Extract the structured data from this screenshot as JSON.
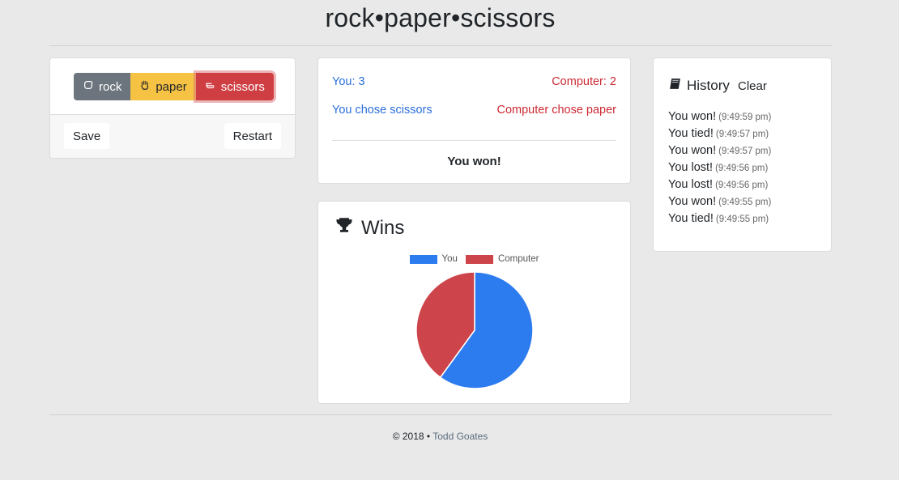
{
  "header": {
    "title": "rock•paper•scissors"
  },
  "controls": {
    "choices": [
      {
        "label": "rock",
        "icon": "hand-rock-icon"
      },
      {
        "label": "paper",
        "icon": "hand-paper-icon"
      },
      {
        "label": "scissors",
        "icon": "hand-scissors-icon"
      }
    ],
    "selected": "scissors",
    "save_label": "Save",
    "restart_label": "Restart"
  },
  "score": {
    "you": "You: 3",
    "computer": "Computer: 2",
    "you_chose": "You chose scissors",
    "computer_chose": "Computer chose paper",
    "result": "You won!"
  },
  "wins": {
    "title": "Wins",
    "icon": "trophy-icon",
    "chart_data": {
      "type": "pie",
      "categories": [
        "You",
        "Computer"
      ],
      "values": [
        3,
        2
      ],
      "colors": [
        "#2c7bef",
        "#cd454a"
      ],
      "legend": "top"
    }
  },
  "history": {
    "title": "History",
    "icon": "book-icon",
    "clear_label": "Clear",
    "items": [
      {
        "result": "You won!",
        "time": "(9:49:59 pm)"
      },
      {
        "result": "You tied!",
        "time": "(9:49:57 pm)"
      },
      {
        "result": "You won!",
        "time": "(9:49:57 pm)"
      },
      {
        "result": "You lost!",
        "time": "(9:49:56 pm)"
      },
      {
        "result": "You lost!",
        "time": "(9:49:56 pm)"
      },
      {
        "result": "You won!",
        "time": "(9:49:55 pm)"
      },
      {
        "result": "You tied!",
        "time": "(9:49:55 pm)"
      }
    ]
  },
  "footer": {
    "copyright": "© 2018 •",
    "author": "Todd Goates"
  }
}
